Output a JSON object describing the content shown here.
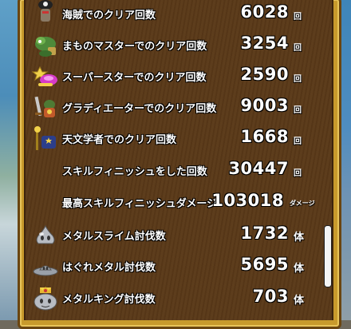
{
  "stats": [
    {
      "label": "海賊でのクリア回数",
      "value": "6028",
      "unit": "回",
      "icon": "pirate-icon"
    },
    {
      "label": "まものマスターでのクリア回数",
      "value": "3254",
      "unit": "回",
      "icon": "monster-master-icon"
    },
    {
      "label": "スーパースターでのクリア回数",
      "value": "2590",
      "unit": "回",
      "icon": "superstar-icon"
    },
    {
      "label": "グラディエーターでのクリア回数",
      "value": "9003",
      "unit": "回",
      "icon": "gladiator-icon"
    },
    {
      "label": "天文学者でのクリア回数",
      "value": "1668",
      "unit": "回",
      "icon": "astronomer-icon"
    },
    {
      "label": "スキルフィニッシュをした回数",
      "value": "30447",
      "unit": "回"
    },
    {
      "label": "最高スキルフィニッシュダメージ",
      "value": "103018",
      "unit": "ダメージ"
    },
    {
      "label": "メタルスライム討伐数",
      "value": "1732",
      "unit": "体",
      "icon": "metal-slime-icon"
    },
    {
      "label": "はぐれメタル討伐数",
      "value": "5695",
      "unit": "体",
      "icon": "liquid-metal-slime-icon"
    },
    {
      "label": "メタルキング討伐数",
      "value": "703",
      "unit": "体",
      "icon": "metal-king-icon"
    }
  ],
  "colors": {
    "panel": "#5a3918",
    "frame": "#c89a2c",
    "text": "#ffffff"
  }
}
